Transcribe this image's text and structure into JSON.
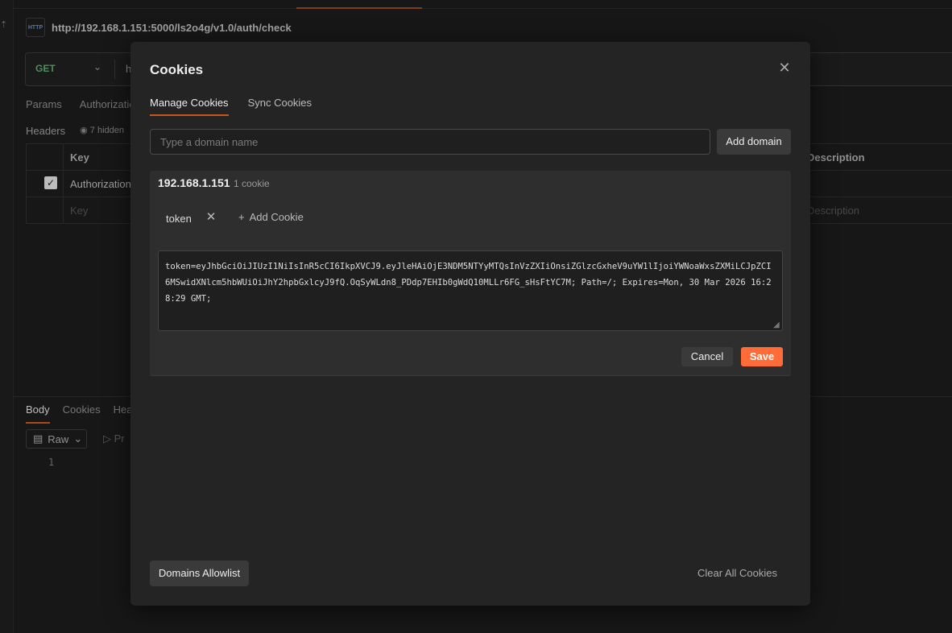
{
  "background": {
    "request_url": "http://192.168.1.151:5000/ls2o4g/v1.0/auth/check",
    "http_badge": "HTTP",
    "method": "GET",
    "url_partial": "h",
    "request_tabs": [
      "Params",
      "Authorizatio"
    ],
    "headers_label": "Headers",
    "hidden_note": "7 hidden",
    "table_headers": {
      "key": "Key",
      "description": "Description"
    },
    "row1_key": "Authorization",
    "row2_key_placeholder": "Key",
    "row2_description_placeholder": "Description",
    "response_tabs": [
      "Body",
      "Cookies",
      "Hea"
    ],
    "raw_label": "Raw",
    "preview_label": "Pr",
    "line_number": "1"
  },
  "modal": {
    "title": "Cookies",
    "tabs": {
      "manage": "Manage Cookies",
      "sync": "Sync Cookies"
    },
    "domain_placeholder": "Type a domain name",
    "add_domain_label": "Add domain",
    "domain": {
      "name": "192.168.1.151",
      "count": "1 cookie",
      "cookie_name": "token",
      "add_cookie_label": "Add Cookie",
      "cookie_value": "token=eyJhbGciOiJIUzI1NiIsInR5cCI6IkpXVCJ9.eyJleHAiOjE3NDM5NTYyMTQsInVzZXIiOnsiZGlzcGxheV9uYW1lIjoiYWNoaWxsZXMiLCJpZCI6MSwidXNlcm5hbWUiOiJhY2hpbGxlcyJ9fQ.OqSyWLdn8_PDdp7EHIb0gWdQ10MLLr6FG_sHsFtYC7M; Path=/; Expires=Mon, 30 Mar 2026 16:28:29 GMT;",
      "cancel_label": "Cancel",
      "save_label": "Save"
    },
    "allowlist_label": "Domains Allowlist",
    "clear_all_label": "Clear All Cookies"
  },
  "colors": {
    "accent": "#ff6c37",
    "tab_underline": "#c8571e",
    "method_get": "#5aa96a"
  }
}
